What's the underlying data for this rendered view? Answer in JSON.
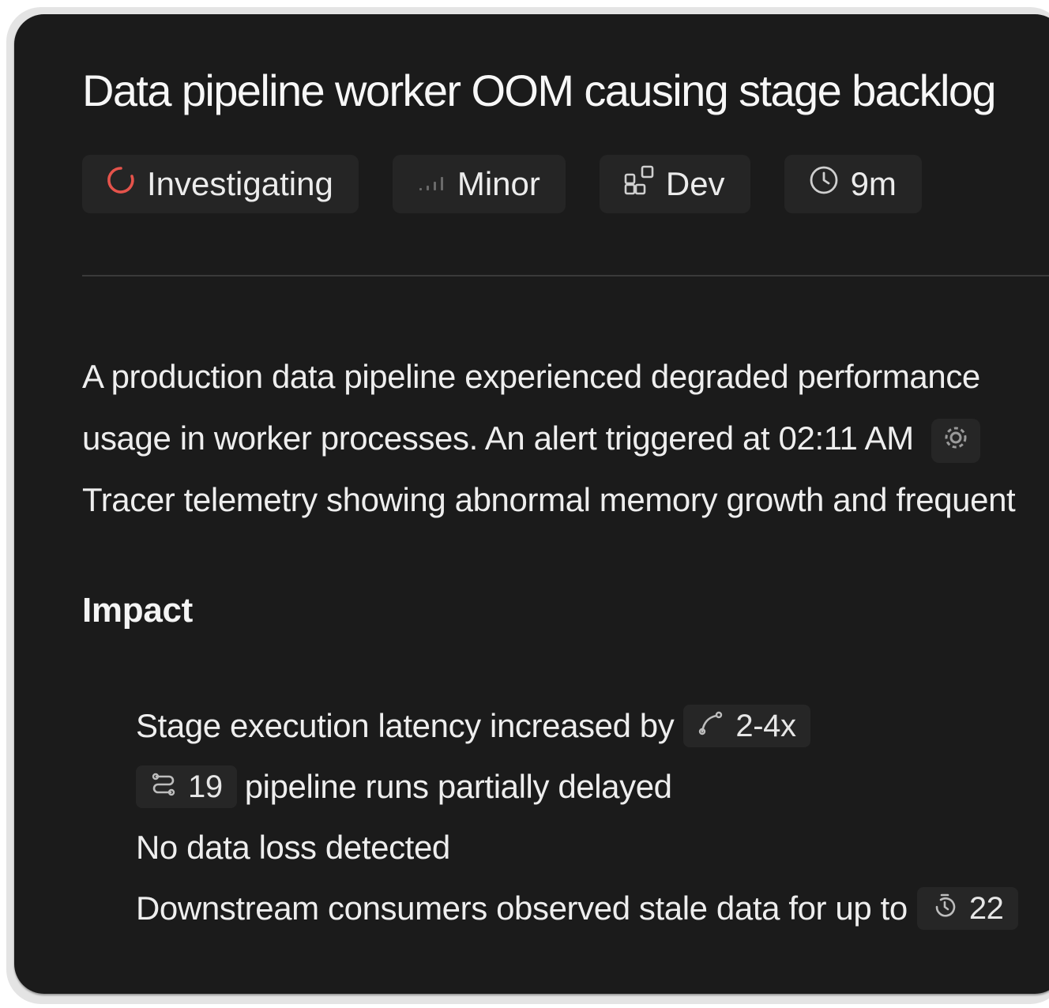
{
  "incident": {
    "title": "Data pipeline worker OOM causing stage backlog",
    "badges": {
      "status": {
        "label": "Investigating",
        "icon": "spinner-icon",
        "color": "#e5534b"
      },
      "severity": {
        "label": "Minor",
        "icon": "signal-bars-icon"
      },
      "environment": {
        "label": "Dev",
        "icon": "blocks-icon"
      },
      "duration": {
        "label": "9m",
        "icon": "clock-icon"
      }
    }
  },
  "summary": {
    "line1": "A production data pipeline experienced degraded performance",
    "line2": "usage in worker processes. An alert triggered at 02:11 AM",
    "line3": "Tracer telemetry showing abnormal memory growth and frequent"
  },
  "impact": {
    "heading": "Impact",
    "items": [
      {
        "text": "Stage execution latency increased by",
        "chip": "2-4x",
        "chip_icon": "trend-curve-icon"
      },
      {
        "chip": "19",
        "chip_icon": "pipeline-icon",
        "text": "pipeline runs partially delayed"
      },
      {
        "text": "No data loss detected"
      },
      {
        "text": "Downstream consumers observed stale data for up to",
        "chip": "22",
        "chip_icon": "timer-icon"
      }
    ]
  }
}
